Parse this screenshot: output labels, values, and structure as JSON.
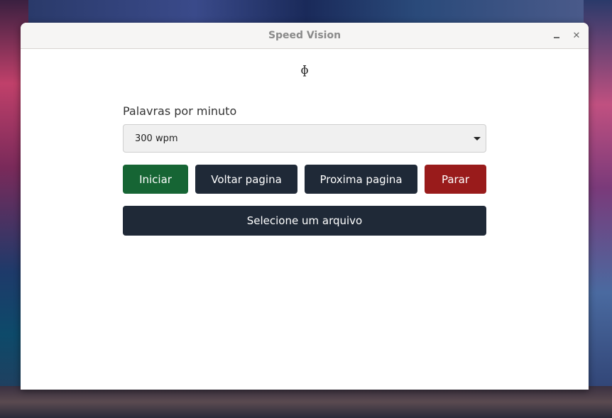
{
  "window": {
    "title": "Speed Vision",
    "minimize_icon": "minimize-icon",
    "close_symbol": "✕"
  },
  "logo": {
    "symbol": "ɸ"
  },
  "speed": {
    "label": "Palavras por minuto",
    "selected": "300 wpm"
  },
  "controls": {
    "start": "Iniciar",
    "prev_page": "Voltar pagina",
    "next_page": "Proxima pagina",
    "stop": "Parar"
  },
  "file": {
    "select_label": "Selecione um arquivo"
  },
  "colors": {
    "start": "#166534",
    "dark": "#1f2937",
    "stop": "#991b1b"
  }
}
